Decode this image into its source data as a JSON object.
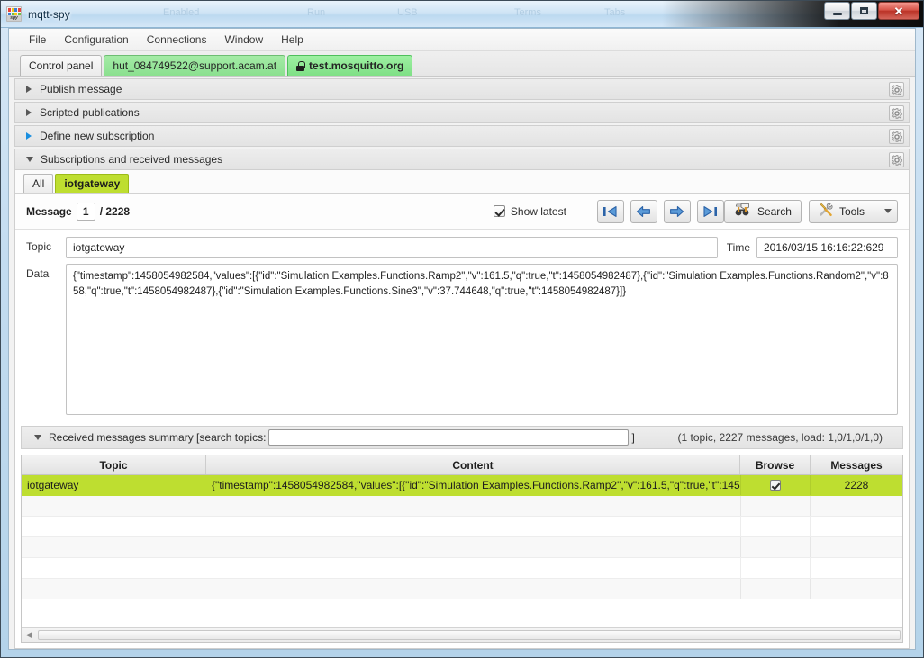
{
  "window": {
    "title": "mqtt-spy",
    "icon": "mqtt-spy-logo-icon",
    "icon_label": "spy",
    "ghost_words": [
      "Enabled",
      "Run",
      "USB",
      "Terms",
      "Tabs"
    ],
    "buttons": {
      "minimize": "minimize-button",
      "maximize": "maximize-button",
      "close_label": "✕"
    }
  },
  "menubar": {
    "items": [
      {
        "label": "File",
        "name": "menu-file"
      },
      {
        "label": "Configuration",
        "name": "menu-configuration"
      },
      {
        "label": "Connections",
        "name": "menu-connections"
      },
      {
        "label": "Window",
        "name": "menu-window"
      },
      {
        "label": "Help",
        "name": "menu-help"
      }
    ]
  },
  "connection_tabs": [
    {
      "label": "Control panel",
      "style": "plain",
      "locked": false,
      "active": false
    },
    {
      "label": "hut_084749522@support.acam.at",
      "style": "green",
      "locked": false,
      "active": false
    },
    {
      "label": "test.mosquitto.org",
      "style": "green",
      "locked": true,
      "active": true
    }
  ],
  "accordions": [
    {
      "label": "Publish message",
      "expanded": false,
      "highlight": false
    },
    {
      "label": "Scripted publications",
      "expanded": false,
      "highlight": false
    },
    {
      "label": "Define new subscription",
      "expanded": false,
      "highlight": true
    },
    {
      "label": "Subscriptions and received messages",
      "expanded": true,
      "highlight": false
    }
  ],
  "subscription_tabs": [
    {
      "label": "All",
      "selected": false
    },
    {
      "label": "iotgateway",
      "selected": true
    }
  ],
  "message_nav": {
    "label": "Message",
    "current": "1",
    "separator": "/ 2228",
    "show_latest_label": "Show latest",
    "show_latest_checked": true,
    "buttons": [
      {
        "name": "first-message-button",
        "icon": "first-arrow-icon"
      },
      {
        "name": "previous-message-button",
        "icon": "left-arrow-icon"
      },
      {
        "name": "next-message-button",
        "icon": "right-arrow-icon"
      },
      {
        "name": "last-message-button",
        "icon": "last-arrow-icon"
      }
    ],
    "search_label": "Search",
    "tools_label": "Tools"
  },
  "message_detail": {
    "topic_label": "Topic",
    "topic_value": "iotgateway",
    "time_label": "Time",
    "time_value": "2016/03/15 16:16:22:629",
    "data_label": "Data",
    "data_value": "{\"timestamp\":1458054982584,\"values\":[{\"id\":\"Simulation Examples.Functions.Ramp2\",\"v\":161.5,\"q\":true,\"t\":1458054982487},{\"id\":\"Simulation Examples.Functions.Random2\",\"v\":858,\"q\":true,\"t\":1458054982487},{\"id\":\"Simulation Examples.Functions.Sine3\",\"v\":37.744648,\"q\":true,\"t\":1458054982487}]}"
  },
  "summary": {
    "title": "Received messages summary [search topics:",
    "close_bracket": "]",
    "search_value": "",
    "stats": "(1 topic, 2227 messages, load: 1,0/1,0/1,0)"
  },
  "table": {
    "headers": [
      "Topic",
      "Content",
      "Browse",
      "Messages"
    ],
    "rows": [
      {
        "topic": "iotgateway",
        "content": "{\"timestamp\":1458054982584,\"values\":[{\"id\":\"Simulation Examples.Functions.Ramp2\",\"v\":161.5,\"q\":true,\"t\":1458…",
        "browse": true,
        "messages": "2228",
        "selected": true
      },
      {
        "topic": "",
        "content": "",
        "browse": false,
        "messages": "",
        "selected": false
      },
      {
        "topic": "",
        "content": "",
        "browse": false,
        "messages": "",
        "selected": false
      },
      {
        "topic": "",
        "content": "",
        "browse": false,
        "messages": "",
        "selected": false
      },
      {
        "topic": "",
        "content": "",
        "browse": false,
        "messages": "",
        "selected": false
      },
      {
        "topic": "",
        "content": "",
        "browse": false,
        "messages": "",
        "selected": false
      }
    ]
  },
  "colors": {
    "tab_green": "#8be08f",
    "tab_active_green": "#7fe086",
    "selection_lime": "#bede30",
    "close_red": "#bb3327",
    "accent_blue": "#1a8fe0"
  }
}
